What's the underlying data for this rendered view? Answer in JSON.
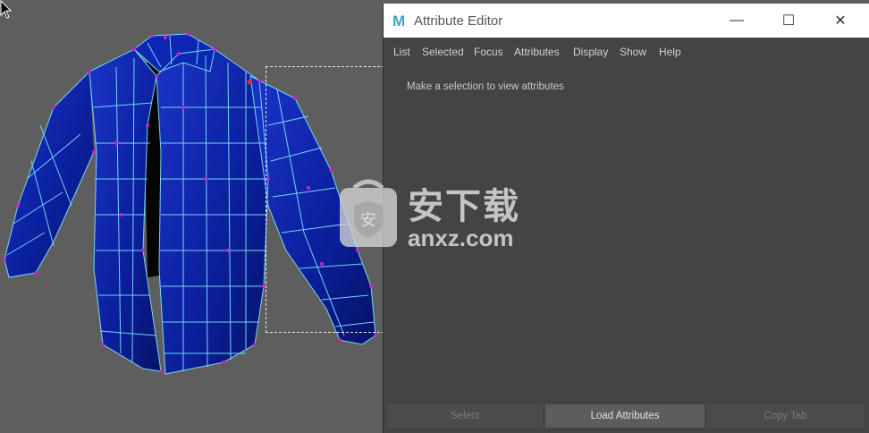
{
  "window": {
    "title": "Attribute Editor",
    "logo_letter": "M",
    "minimize_glyph": "—",
    "maximize_glyph": "☐",
    "close_glyph": "✕"
  },
  "menu": {
    "items": [
      {
        "label": "List"
      },
      {
        "label": "Selected"
      },
      {
        "label": "Focus"
      },
      {
        "label": "Attributes"
      },
      {
        "label": "Display"
      },
      {
        "label": "Show"
      },
      {
        "label": "Help"
      }
    ]
  },
  "main": {
    "message": "Make a selection to view attributes"
  },
  "buttons": {
    "select": "Select",
    "load_attributes": "Load Attributes",
    "copy_tab": "Copy Tab"
  },
  "watermark": {
    "text": "安下载",
    "url": "anxz.com",
    "badge_glyph": "安"
  },
  "colors": {
    "shirt": "#0a1f9e",
    "wire": "#7fe8ff",
    "vertex": "#cc22cc",
    "accent_logo": "#3aa7c9"
  }
}
